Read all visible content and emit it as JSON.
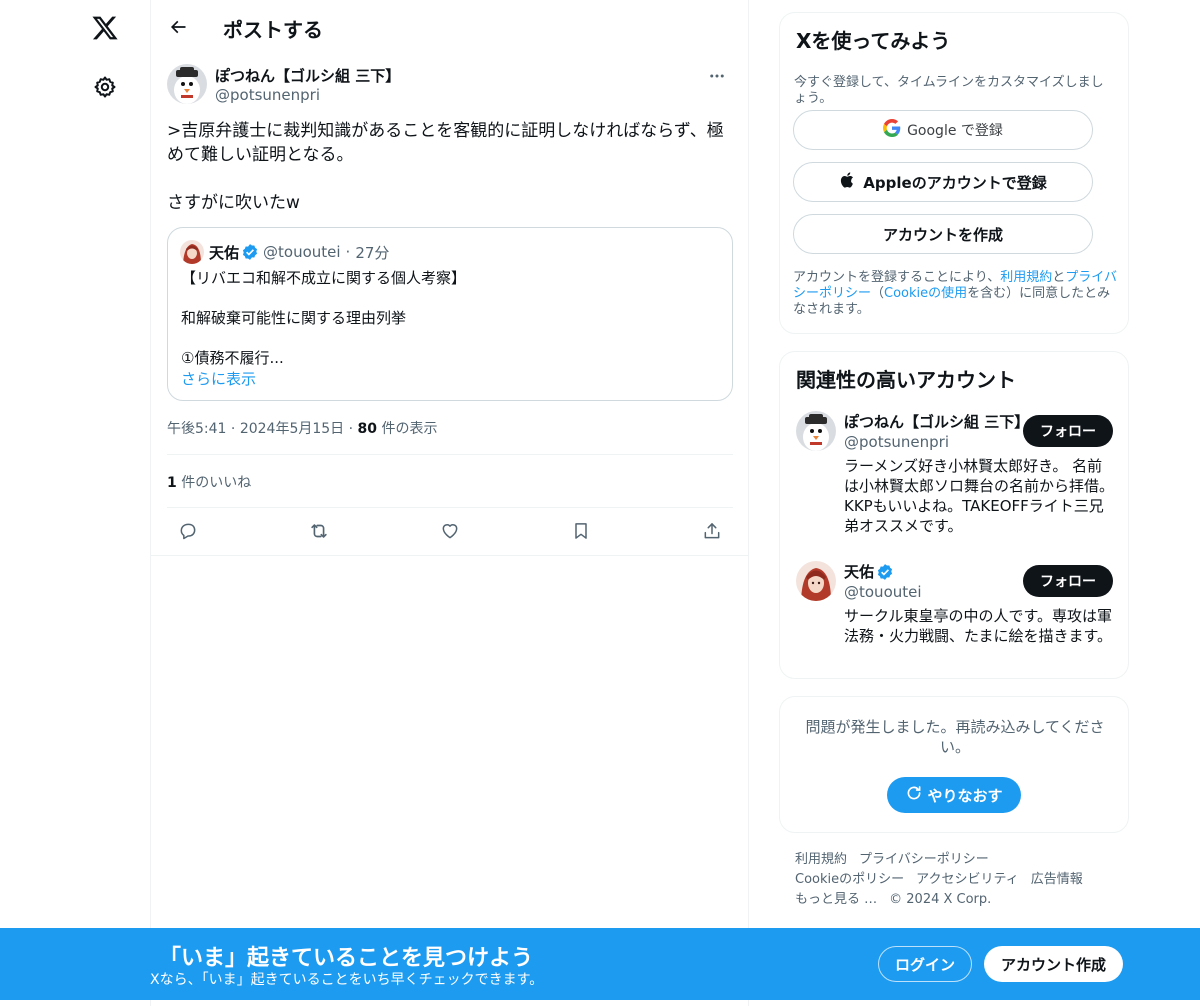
{
  "header": {
    "title": "ポストする"
  },
  "post": {
    "author_name": "ぽつねん【ゴルシ組 三下】",
    "author_handle": "@potsunenpri",
    "text_line1": ">吉原弁護士に裁判知識があることを客観的に証明しなければならず、極めて難しい証明となる。",
    "text_line2": "さすがに吹いたw",
    "quote": {
      "name": "天佑",
      "handle": "@tououtei",
      "dot": "·",
      "time": "27分",
      "line1": "【リバエコ和解不成立に関する個人考察】",
      "line2": "和解破棄可能性に関する理由列挙",
      "line3": "①債務不履行...",
      "more": "さらに表示"
    },
    "time": "午後5:41",
    "date": "2024年5月15日",
    "views_count": "80",
    "views_label": " 件の表示",
    "likes_count": "1",
    "likes_label": " 件のいいね"
  },
  "signup": {
    "title": "Xを使ってみよう",
    "subtitle": "今すぐ登録して、タイムラインをカスタマイズしましょう。",
    "google_label": "Google で登録",
    "apple_label": "Appleのアカウントで登録",
    "create_label": "アカウントを作成",
    "legal_1": "アカウントを登録することにより、",
    "legal_terms": "利用規約",
    "legal_2": "と",
    "legal_privacy": "プライバシーポリシー",
    "legal_3": "（",
    "legal_cookie": "Cookieの使用",
    "legal_4": "を含む）に同意したとみなされます。"
  },
  "accounts": {
    "title": "関連性の高いアカウント",
    "items": [
      {
        "name": "ぽつねん【ゴルシ組 三下】",
        "handle": "@potsunenpri",
        "bio": "ラーメンズ好き小林賢太郎好き。 名前は小林賢太郎ソロ舞台の名前から拝借。 KKPもいいよね。TAKEOFFライト三兄弟オススメです。",
        "follow": "フォロー"
      },
      {
        "name": "天佑",
        "handle": "@tououtei",
        "bio": "サークル東皇亭の中の人です。専攻は軍法務・火力戦闘、たまに絵を描きます。",
        "follow": "フォロー"
      }
    ]
  },
  "error": {
    "message": "問題が発生しました。再読み込みしてください。",
    "retry": "やりなおす"
  },
  "footer": {
    "terms": "利用規約",
    "privacy": "プライバシーポリシー",
    "cookie": "Cookieのポリシー",
    "accessibility": "アクセシビリティ",
    "ads": "広告情報",
    "more": "もっと見る …",
    "copyright": "© 2024 X Corp."
  },
  "bottom_bar": {
    "title": "「いま」起きていることを見つけよう",
    "subtitle": "Xなら、「いま」起きていることをいち早くチェックできます。",
    "login": "ログイン",
    "signup": "アカウント作成"
  },
  "colors": {
    "accent": "#1d9bf0",
    "text": "#0f1419",
    "secondary": "#536471",
    "border": "#eff3f4"
  },
  "icons": [
    "x-logo-icon",
    "gear-icon",
    "back-arrow-icon",
    "more-icon",
    "verified-icon",
    "reply-icon",
    "repost-icon",
    "like-icon",
    "bookmark-icon",
    "share-icon",
    "google-icon",
    "apple-icon",
    "refresh-icon"
  ]
}
